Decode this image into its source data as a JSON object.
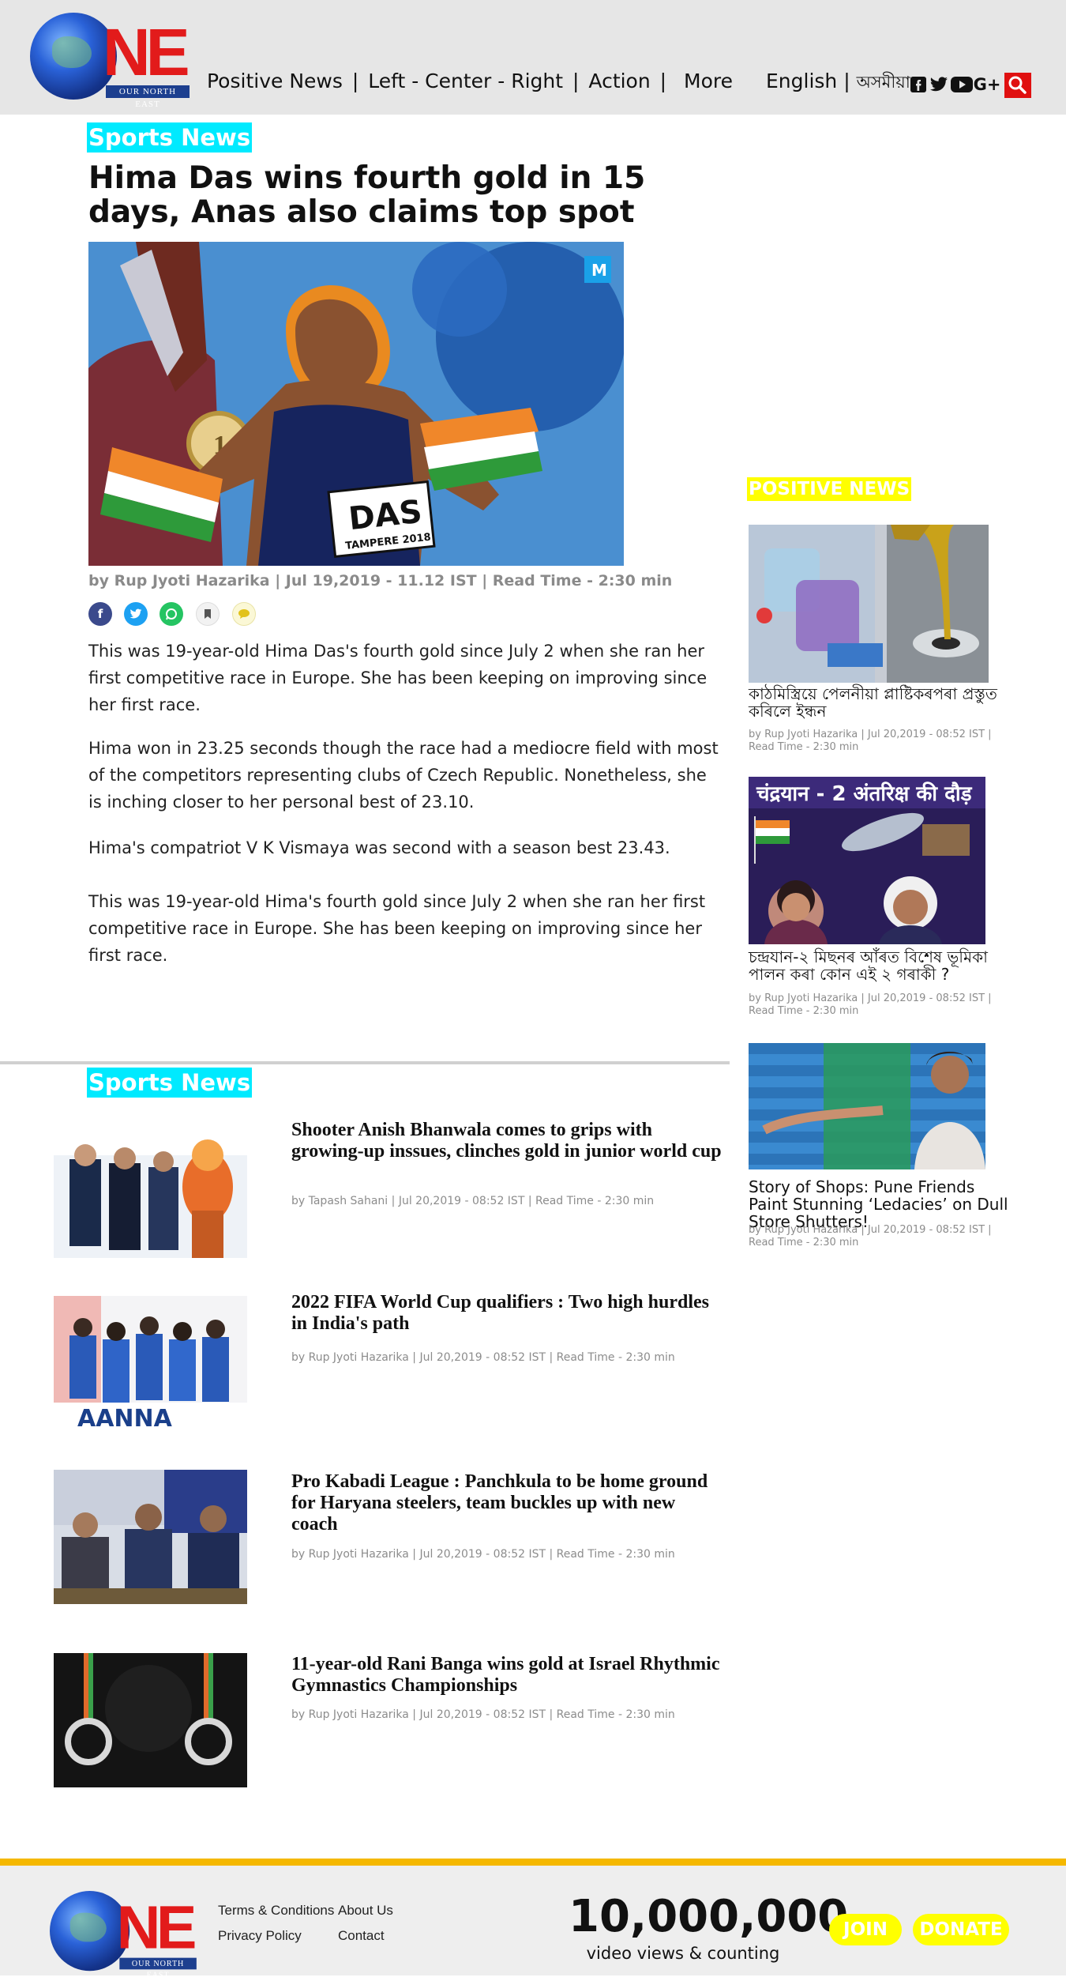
{
  "header": {
    "logo_text": "NE",
    "logo_tag": "OUR NORTH EAST",
    "nav": [
      "Positive News",
      "|",
      "Left - Center - Right",
      "|",
      "Action",
      "|",
      "More"
    ],
    "lang_english": "English",
    "lang_sep": "|",
    "lang_assamese": "অসমীয়া",
    "social_icons": [
      "facebook-icon",
      "twitter-icon",
      "youtube-icon",
      "google-plus-icon"
    ],
    "gplus_text": "G+"
  },
  "article": {
    "category": "Sports News",
    "headline": "Hima Das wins fourth gold in 15 days, Anas also claims top spot",
    "hero_bib": "DAS",
    "hero_bib_sub": "TAMPERE 2018",
    "hero_badge": "M",
    "byline": "by Rup Jyoti Hazarika | Jul 19,2019 - 11.12 IST | Read Time - 2:30 min",
    "share_icons": [
      "facebook-icon",
      "twitter-icon",
      "whatsapp-icon",
      "bookmark-icon",
      "comment-icon"
    ],
    "paragraphs": [
      "This was 19-year-old Hima Das's fourth gold since July 2 when she ran her first competitive race in Europe. She has been keeping on improving since her first race.",
      "Hima won in 23.25 seconds though the race had a mediocre field with most of the competitors representing clubs of Czech Republic. Nonetheless, she is inching closer to her personal best of 23.10.",
      "Hima's compatriot V K Vismaya was second with a season best 23.43.",
      "This was 19-year-old Hima's fourth gold since July 2 when she ran her first competitive race in Europe. She has been keeping on improving since her first race."
    ]
  },
  "related": {
    "category": "Sports News",
    "items": [
      {
        "title": "Shooter Anish Bhanwala comes to grips with growing-up inssues, clinches gold in junior world cup",
        "meta": "by Tapash Sahani | Jul 20,2019 - 08:52 IST | Read Time - 2:30 min"
      },
      {
        "title": "2022 FIFA World Cup qualifiers : Two high hurdles in India's path",
        "meta": "by Rup Jyoti Hazarika | Jul 20,2019 - 08:52 IST | Read Time - 2:30 min"
      },
      {
        "title": "Pro Kabadi League : Panchkula to be home ground for  Haryana steelers, team buckles up with new coach",
        "meta": "by Rup Jyoti Hazarika | Jul 20,2019 - 08:52 IST | Read Time - 2:30 min"
      },
      {
        "title": "11-year-old Rani Banga wins gold at Israel Rhythmic Gymnastics Championships",
        "meta": "by Rup Jyoti Hazarika | Jul 20,2019 - 08:52 IST | Read Time - 2:30 min"
      }
    ]
  },
  "sidebar": {
    "label": "POSITIVE NEWS",
    "items": [
      {
        "title": "কাঠমিস্ত্ৰিয়ে পেলনীয়া প্লাষ্টিকৰপৰা প্ৰস্তুত কৰিলে ইন্ধন",
        "meta": "by Rup Jyoti Hazarika | Jul 20,2019 - 08:52 IST | Read Time - 2:30 min"
      },
      {
        "title": "চন্দ্ৰযান-২ মিছনৰ আঁৰত বিশেষ ভূমিকা পালন কৰা কোন এই ২ গৰাকী ?",
        "meta": "by Rup Jyoti Hazarika | Jul 20,2019 - 08:52 IST | Read Time - 2:30 min",
        "image_caption": "चंद्रयान - 2  अंतरिक्ष की दौड़"
      },
      {
        "title": "Story of Shops: Pune Friends Paint Stunning ‘Ledacies’ on Dull Store Shutters!",
        "meta": "by Rup Jyoti Hazarika | Jul 20,2019 - 08:52 IST | Read Time - 2:30 min"
      }
    ]
  },
  "footer": {
    "links": [
      "Terms & Conditions",
      "About Us",
      "Privacy Policy",
      "Contact"
    ],
    "counter": "10,000,000",
    "counter_sub": "video views & counting",
    "join": "JOIN",
    "donate": "DONATE"
  },
  "colors": {
    "category_bg": "#00eaff",
    "positive_bg": "#ffff00",
    "footer_bar": "#f5b800",
    "search_bg": "#e01010"
  }
}
